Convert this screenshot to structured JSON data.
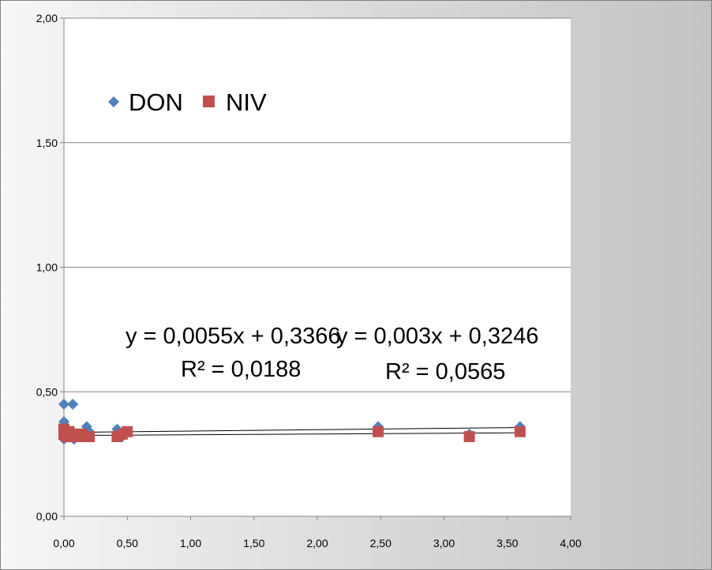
{
  "chart_data": {
    "type": "scatter",
    "title": "",
    "xlabel": "",
    "ylabel": "",
    "xlim": [
      0,
      4
    ],
    "ylim": [
      0,
      2
    ],
    "x_ticks": [
      "0,00",
      "0,50",
      "1,00",
      "1,50",
      "2,00",
      "2,50",
      "3,00",
      "3,50",
      "4,00"
    ],
    "y_ticks": [
      "0,00",
      "0,50",
      "1,00",
      "1,50",
      "2,00"
    ],
    "grid": "horizontal",
    "legend_position": "top-left",
    "series": [
      {
        "name": "DON",
        "marker": "diamond",
        "color": "#4f81bd",
        "points": [
          [
            0.0,
            0.45
          ],
          [
            0.07,
            0.45
          ],
          [
            0.0,
            0.38
          ],
          [
            0.0,
            0.31
          ],
          [
            0.02,
            0.33
          ],
          [
            0.04,
            0.32
          ],
          [
            0.08,
            0.31
          ],
          [
            0.1,
            0.32
          ],
          [
            0.12,
            0.33
          ],
          [
            0.18,
            0.36
          ],
          [
            0.2,
            0.34
          ],
          [
            0.42,
            0.35
          ],
          [
            0.46,
            0.32
          ],
          [
            2.48,
            0.36
          ],
          [
            3.2,
            0.33
          ],
          [
            3.6,
            0.36
          ]
        ],
        "trendline": {
          "slope": 0.0055,
          "intercept": 0.3366,
          "equation": "y = 0,0055x + 0,3366",
          "r2": "R² = 0,0188"
        }
      },
      {
        "name": "NIV",
        "marker": "square",
        "color": "#c0504d",
        "points": [
          [
            0.0,
            0.35
          ],
          [
            0.0,
            0.33
          ],
          [
            0.02,
            0.32
          ],
          [
            0.04,
            0.34
          ],
          [
            0.06,
            0.32
          ],
          [
            0.08,
            0.33
          ],
          [
            0.1,
            0.32
          ],
          [
            0.14,
            0.33
          ],
          [
            0.16,
            0.32
          ],
          [
            0.2,
            0.32
          ],
          [
            0.42,
            0.32
          ],
          [
            0.46,
            0.33
          ],
          [
            0.5,
            0.34
          ],
          [
            2.48,
            0.34
          ],
          [
            3.2,
            0.32
          ],
          [
            3.6,
            0.34
          ]
        ],
        "trendline": {
          "slope": 0.003,
          "intercept": 0.3246,
          "equation": "y = 0,003x + 0,3246",
          "r2": "R² = 0,0565"
        }
      }
    ]
  }
}
